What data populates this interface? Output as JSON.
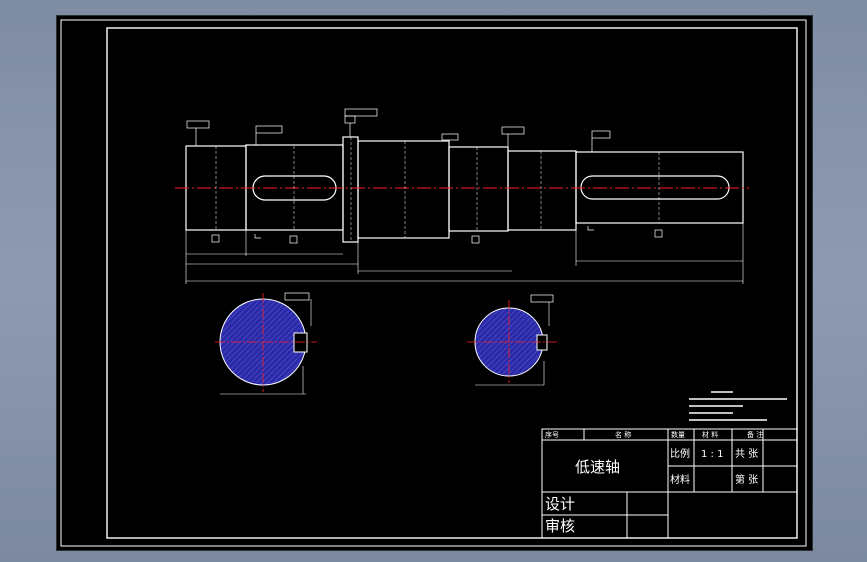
{
  "drawing": {
    "part_name": "低速轴"
  },
  "title_block": {
    "headers": [
      "序号",
      "名 称",
      "数量",
      "材 料",
      "备 注"
    ],
    "scale_label": "比例",
    "scale_value": "1 : 1",
    "material_label": "材料",
    "sheets_total_label": "共 张",
    "sheet_no_label": "第 张",
    "design_label": "设计",
    "review_label": "审核"
  },
  "colors": {
    "background": "#000000",
    "lines": "#ffffff",
    "centerline": "#ff2020",
    "section_fill": "#2a2aa8",
    "frame_outside": "#8a97ad"
  }
}
